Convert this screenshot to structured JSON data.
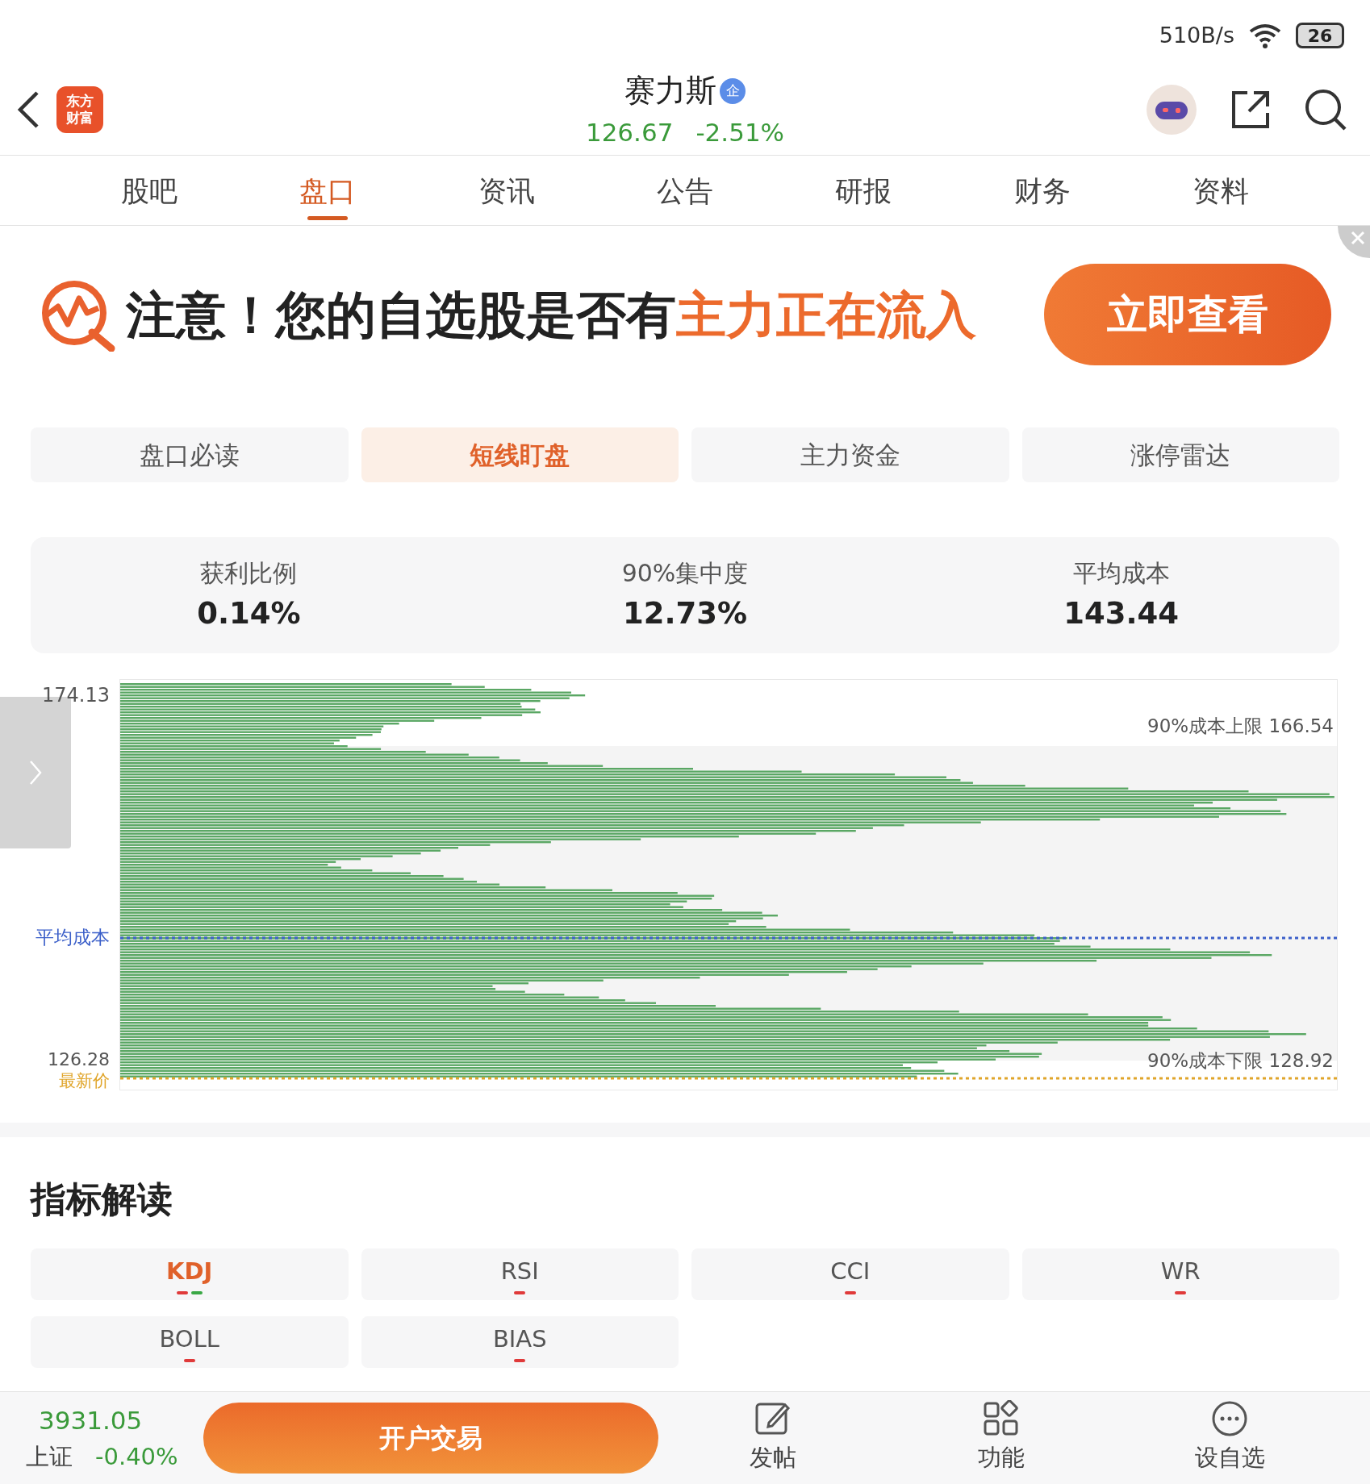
{
  "status_bar": {
    "speed": "510B/s",
    "battery": "26"
  },
  "header": {
    "logo": [
      "东方",
      "财富"
    ],
    "title": "赛力斯",
    "badge": "企",
    "price": "126.67",
    "change": "-2.51%"
  },
  "tabs": [
    {
      "label": "股吧",
      "selected": false
    },
    {
      "label": "盘口",
      "selected": true
    },
    {
      "label": "资讯",
      "selected": false
    },
    {
      "label": "公告",
      "selected": false
    },
    {
      "label": "研报",
      "selected": false
    },
    {
      "label": "财务",
      "selected": false
    },
    {
      "label": "资料",
      "selected": false
    }
  ],
  "banner": {
    "text": "注意！您的自选股是否有",
    "highlight": "主力正在流入",
    "button": "立即查看"
  },
  "sub_tabs": [
    {
      "label": "盘口必读",
      "selected": false
    },
    {
      "label": "短线盯盘",
      "selected": true
    },
    {
      "label": "主力资金",
      "selected": false
    },
    {
      "label": "涨停雷达",
      "selected": false
    }
  ],
  "stats": [
    {
      "label": "获利比例",
      "value": "0.14%"
    },
    {
      "label": "90%集中度",
      "value": "12.73%"
    },
    {
      "label": "平均成本",
      "value": "143.44"
    }
  ],
  "chip_chart": {
    "top_label": "174.13",
    "bottom_label": "126.28",
    "avg_label": "平均成本",
    "latest_label": "最新价",
    "upper_limit": "90%成本上限 166.54",
    "lower_limit": "90%成本下限 128.92"
  },
  "indicators": {
    "title": "指标解读",
    "items": [
      {
        "label": "KDJ",
        "selected": true,
        "marks": [
          {
            "color": "#e03a3a"
          },
          {
            "color": "#3aa845"
          }
        ]
      },
      {
        "label": "RSI",
        "selected": false,
        "marks": [
          {
            "color": "#e03a3a"
          }
        ]
      },
      {
        "label": "CCI",
        "selected": false,
        "marks": [
          {
            "color": "#e03a3a"
          }
        ]
      },
      {
        "label": "WR",
        "selected": false,
        "marks": [
          {
            "color": "#e03a3a"
          }
        ]
      },
      {
        "label": "BOLL",
        "selected": false,
        "marks": [
          {
            "color": "#e03a3a"
          }
        ]
      },
      {
        "label": "BIAS",
        "selected": false,
        "marks": [
          {
            "color": "#e03a3a"
          }
        ]
      }
    ]
  },
  "bottom_bar": {
    "index_value": "3931.05",
    "index_name": "上证",
    "index_change": "-0.40%",
    "trade_button": "开户交易",
    "actions": [
      {
        "label": "发帖",
        "kind": "post"
      },
      {
        "label": "功能",
        "kind": "apps"
      },
      {
        "label": "设自选",
        "kind": "more"
      }
    ]
  }
}
